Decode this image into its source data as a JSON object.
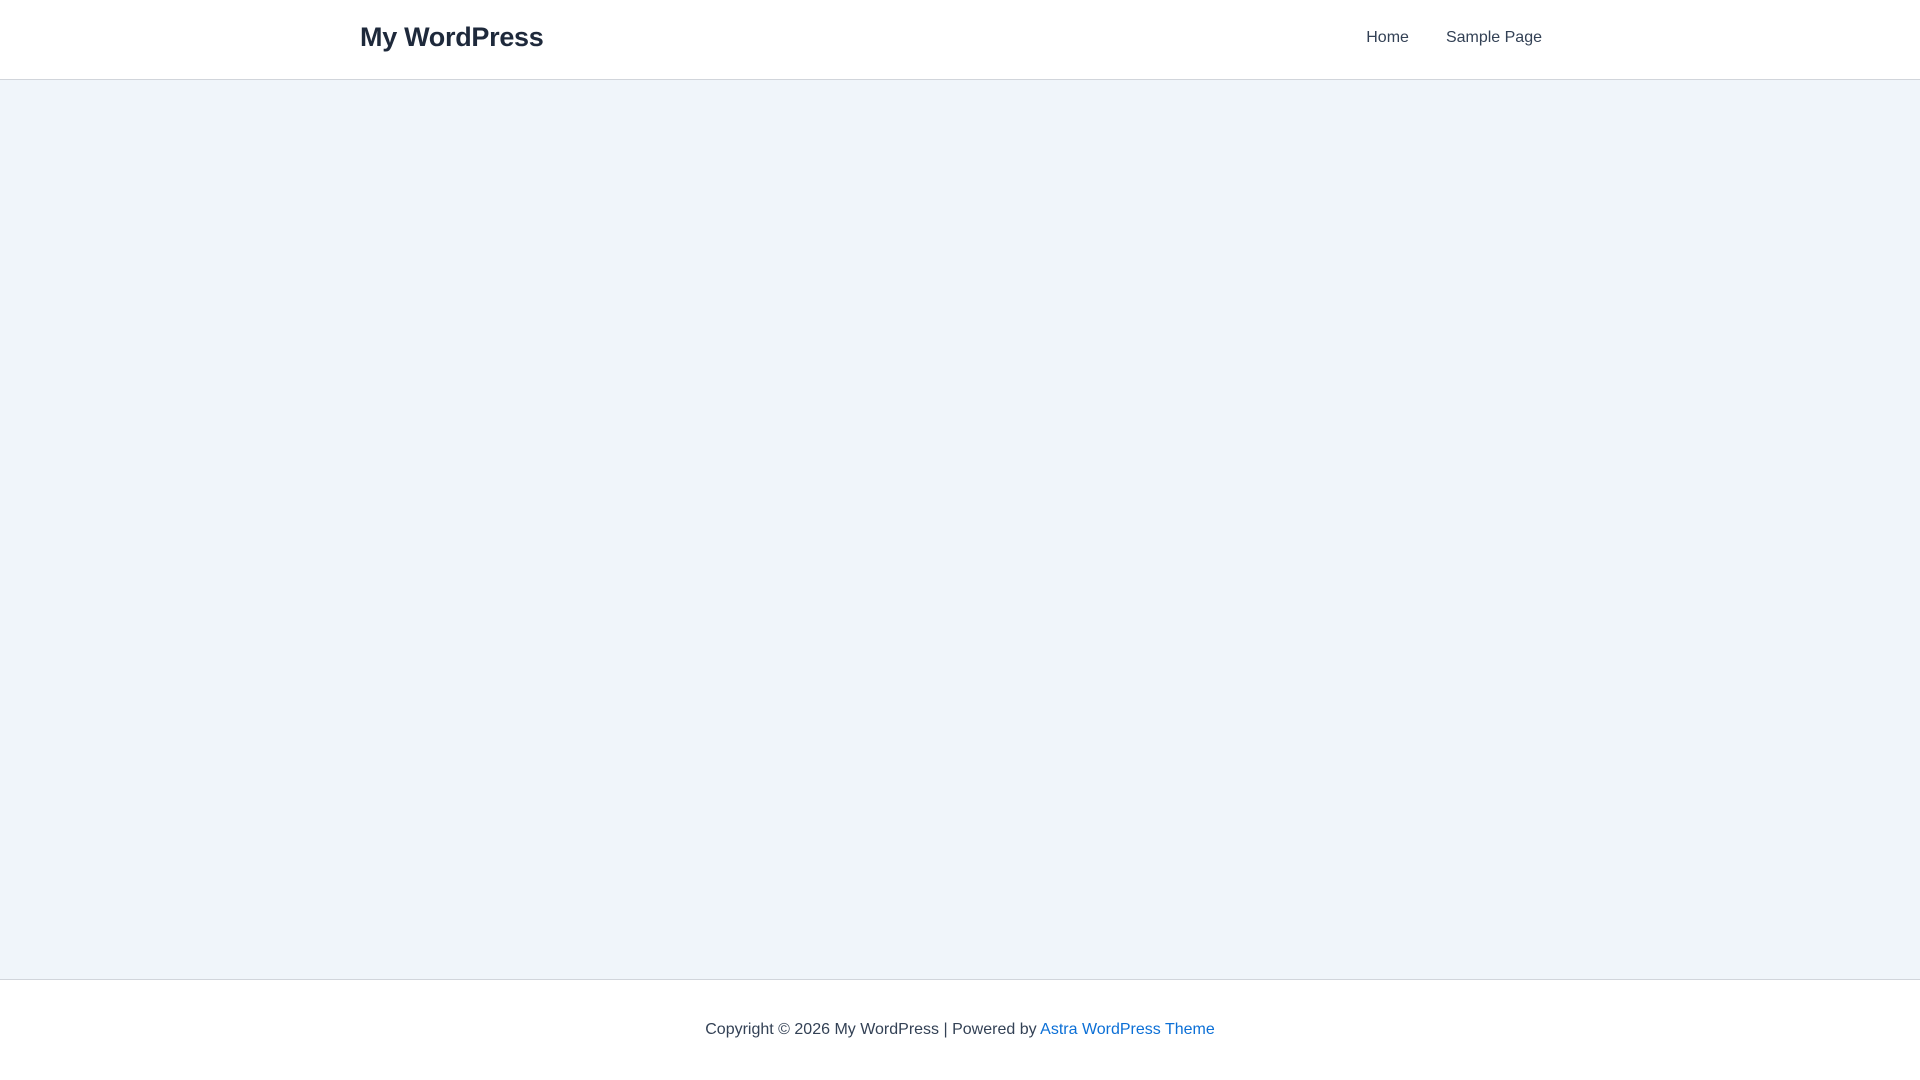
{
  "header": {
    "site_title": "My WordPress",
    "nav": [
      {
        "label": "Home"
      },
      {
        "label": "Sample Page"
      }
    ]
  },
  "footer": {
    "copyright": "Copyright © 2026 My WordPress | Powered by ",
    "theme_link": "Astra WordPress Theme"
  },
  "colors": {
    "background": "#f0f5fa",
    "link": "#0b6fd6",
    "title": "#1e293b"
  }
}
